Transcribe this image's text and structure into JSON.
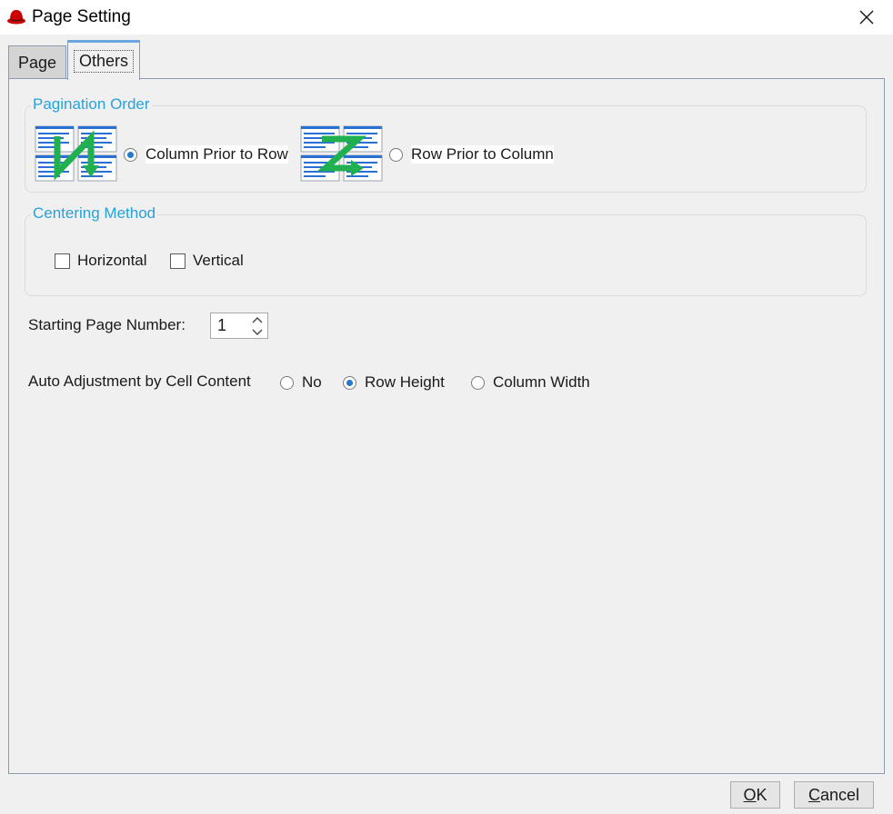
{
  "window": {
    "title": "Page Setting"
  },
  "tabs": [
    {
      "label": "Page"
    },
    {
      "label": "Others"
    }
  ],
  "pagination_order": {
    "title": "Pagination Order",
    "options": [
      {
        "label": "Column Prior to Row",
        "selected": true
      },
      {
        "label": "Row Prior to Column",
        "selected": false
      }
    ]
  },
  "centering_method": {
    "title": "Centering Method",
    "horizontal": {
      "label": "Horizontal",
      "checked": false
    },
    "vertical": {
      "label": "Vertical",
      "checked": false
    }
  },
  "starting_page": {
    "label": "Starting Page Number:",
    "value": "1"
  },
  "auto_adjust": {
    "label": "Auto Adjustment by Cell Content",
    "options": [
      {
        "label": "No",
        "selected": false
      },
      {
        "label": "Row Height",
        "selected": true
      },
      {
        "label": "Column Width",
        "selected": false
      }
    ]
  },
  "buttons": {
    "ok": {
      "mnemonic": "O",
      "rest": "K"
    },
    "cancel": {
      "mnemonic": "C",
      "rest": "ancel"
    }
  },
  "colors": {
    "accent": "#27a2da",
    "arrow_green": "#20b050",
    "page_blue": "#2a6fd6",
    "radio_dot": "#2878c8"
  }
}
